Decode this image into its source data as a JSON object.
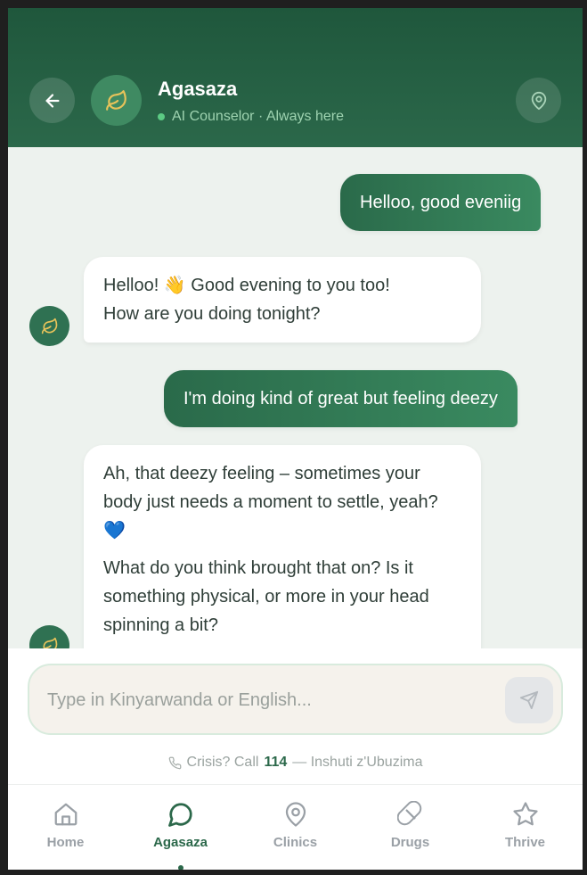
{
  "header": {
    "title": "Agasaza",
    "status_text": "AI Counselor · Always here"
  },
  "messages": [
    {
      "role": "user",
      "text": "Helloo, good eveniig"
    },
    {
      "role": "bot",
      "lines": [
        "Helloo! 👋 Good evening to you too!",
        "How are you doing tonight?"
      ]
    },
    {
      "role": "user",
      "text": "I'm doing kind of great but feeling deezy"
    },
    {
      "role": "bot",
      "paragraphs": [
        "Ah, that deezy feeling – sometimes your body just needs a moment to settle, yeah? 💙",
        "What do you think brought that on? Is it something physical, or more in your head spinning a bit?"
      ]
    }
  ],
  "composer": {
    "placeholder": "Type in Kinyarwanda or English...",
    "value": ""
  },
  "crisis": {
    "prefix": "Crisis? Call",
    "number": "114",
    "suffix": "— Inshuti z'Ubuzima"
  },
  "nav": {
    "items": [
      {
        "label": "Home",
        "icon": "home-icon",
        "active": false
      },
      {
        "label": "Agasaza",
        "icon": "chat-icon",
        "active": true
      },
      {
        "label": "Clinics",
        "icon": "map-pin-icon",
        "active": false
      },
      {
        "label": "Drugs",
        "icon": "pill-icon",
        "active": false
      },
      {
        "label": "Thrive",
        "icon": "star-icon",
        "active": false
      }
    ]
  },
  "colors": {
    "brand": "#2b684a",
    "header_bg": "#1f573c",
    "chat_bg": "#edf2ee",
    "leaf": "#e8c35a"
  }
}
